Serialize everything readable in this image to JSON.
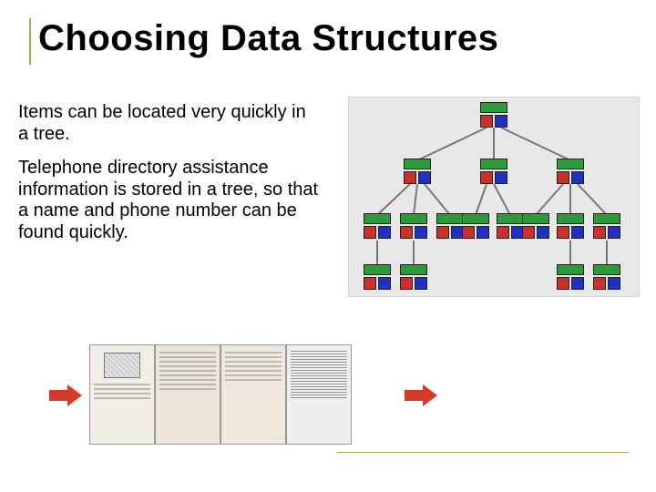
{
  "slide": {
    "title": "Choosing Data Structures",
    "p1": "Items can be located very quickly in a tree.",
    "p2": "Telephone directory assistance information is stored in a tree, so that a name and phone number can be found quickly."
  },
  "icons": {
    "arrow_left": "red-arrow",
    "arrow_right": "red-arrow",
    "tree_node": "tree-node"
  },
  "colors": {
    "accent_rule": "#b0a060",
    "arrow": "#d43a2a",
    "node_green": "#2e9a3c",
    "node_red": "#c93030",
    "node_blue": "#2030c0"
  }
}
